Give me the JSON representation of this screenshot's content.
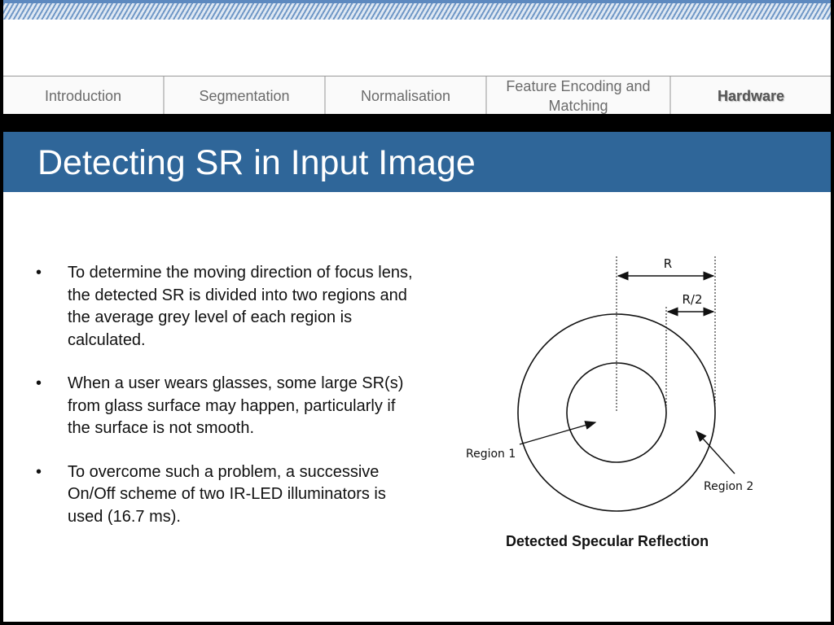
{
  "nav": {
    "tabs": [
      {
        "label": "Introduction"
      },
      {
        "label": "Segmentation"
      },
      {
        "label": "Normalisation"
      },
      {
        "label": "Feature Encoding and Matching"
      },
      {
        "label": "Hardware",
        "active": true
      }
    ]
  },
  "slide": {
    "title": "Detecting SR in Input Image",
    "bullet_marker": "•",
    "bullets": [
      "To determine the moving direction of focus lens, the detected SR is divided into two regions and the average grey level of each region is calculated.",
      "When a user wears glasses, some large SR(s) from glass surface may happen, particularly if the surface is not smooth.",
      "To overcome such a problem, a successive On/Off scheme of two IR-LED illuminators is used (16.7 ms)."
    ]
  },
  "figure": {
    "label_r": "R",
    "label_r_half": "R/2",
    "label_region1": "Region 1",
    "label_region2": "Region 2",
    "caption": "Detected Specular Reflection"
  },
  "colors": {
    "title_bar": "#2f6699",
    "top_stripe": "#5d89bf",
    "title_text": "#ffffff"
  }
}
